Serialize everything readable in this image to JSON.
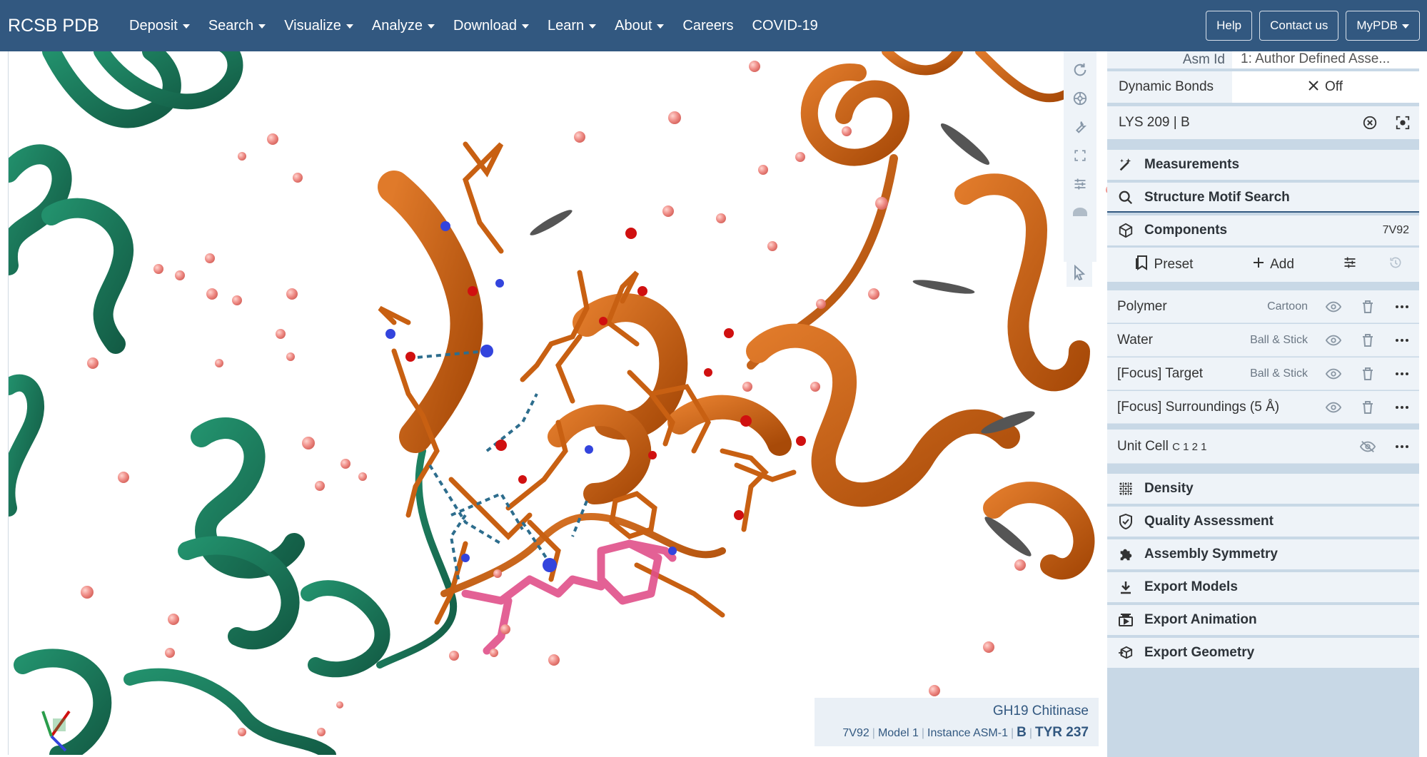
{
  "nav": {
    "brand": "RCSB PDB",
    "menu": [
      {
        "label": "Deposit",
        "dropdown": true
      },
      {
        "label": "Search",
        "dropdown": true
      },
      {
        "label": "Visualize",
        "dropdown": true
      },
      {
        "label": "Analyze",
        "dropdown": true
      },
      {
        "label": "Download",
        "dropdown": true
      },
      {
        "label": "Learn",
        "dropdown": true
      },
      {
        "label": "About",
        "dropdown": true
      },
      {
        "label": "Careers",
        "dropdown": false
      },
      {
        "label": "COVID-19",
        "dropdown": false
      }
    ],
    "help": "Help",
    "contact": "Contact us",
    "mypdb": "MyPDB"
  },
  "viewer": {
    "toolbar_icons": [
      "reset-camera-icon",
      "screenshot-icon",
      "settings-wrench-icon",
      "fullscreen-icon",
      "controls-icon",
      "toggle-3d-icon",
      "selection-mode-icon"
    ],
    "info": {
      "title": "GH19 Chitinase",
      "entry": "7V92",
      "model": "Model 1",
      "instance": "Instance ASM-1",
      "chain": "B",
      "residue": "TYR 237"
    }
  },
  "panel": {
    "asm_label": "Asm Id",
    "asm_value": "1: Author Defined Asse...",
    "dynamic_bonds_label": "Dynamic Bonds",
    "dynamic_bonds_value": "Off",
    "focus_label": "LYS 209 | B",
    "measurements": "Measurements",
    "motif_search": "Structure Motif Search",
    "components": "Components",
    "components_badge": "7V92",
    "preset": "Preset",
    "add": "Add",
    "component_items": [
      {
        "name": "Polymer",
        "repr": "Cartoon"
      },
      {
        "name": "Water",
        "repr": "Ball & Stick"
      },
      {
        "name": "[Focus] Target",
        "repr": "Ball & Stick"
      },
      {
        "name": "[Focus] Surroundings (5 Å)",
        "repr": ""
      }
    ],
    "unit_cell": "Unit Cell",
    "unit_cell_group": "C 1 2 1",
    "sections": [
      {
        "label": "Density",
        "icon": "density-grid-icon"
      },
      {
        "label": "Quality Assessment",
        "icon": "shield-check-icon"
      },
      {
        "label": "Assembly Symmetry",
        "icon": "puzzle-icon"
      },
      {
        "label": "Export Models",
        "icon": "download-icon"
      },
      {
        "label": "Export Animation",
        "icon": "animation-icon"
      },
      {
        "label": "Export Geometry",
        "icon": "cube-export-icon"
      }
    ]
  },
  "colors": {
    "navbar": "#325880",
    "chain_a": "#1b7a5c",
    "chain_b": "#c85a0b",
    "highlight": "#e0508a",
    "water": "#ef8d87"
  }
}
